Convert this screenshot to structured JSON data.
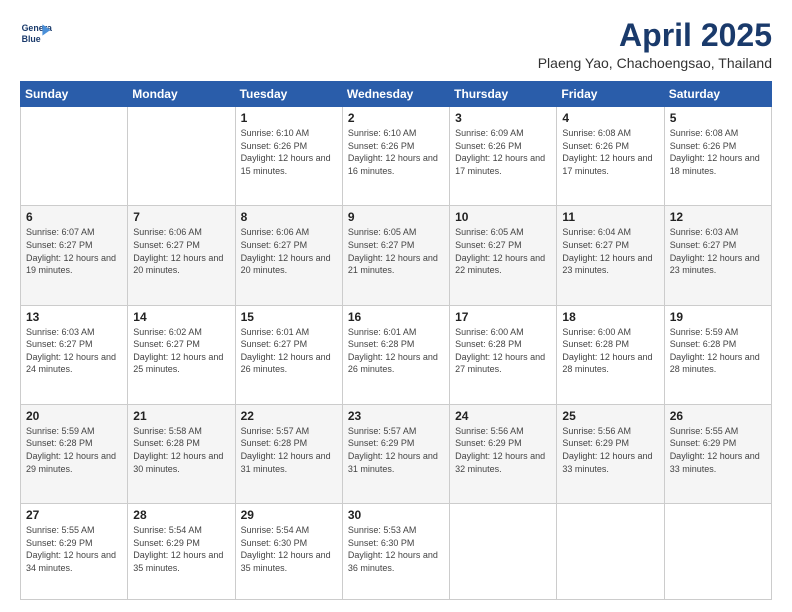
{
  "logo": {
    "line1": "General",
    "line2": "Blue"
  },
  "title": "April 2025",
  "location": "Plaeng Yao, Chachoengsao, Thailand",
  "days_of_week": [
    "Sunday",
    "Monday",
    "Tuesday",
    "Wednesday",
    "Thursday",
    "Friday",
    "Saturday"
  ],
  "weeks": [
    [
      {
        "day": "",
        "info": ""
      },
      {
        "day": "",
        "info": ""
      },
      {
        "day": "1",
        "info": "Sunrise: 6:10 AM\nSunset: 6:26 PM\nDaylight: 12 hours and 15 minutes."
      },
      {
        "day": "2",
        "info": "Sunrise: 6:10 AM\nSunset: 6:26 PM\nDaylight: 12 hours and 16 minutes."
      },
      {
        "day": "3",
        "info": "Sunrise: 6:09 AM\nSunset: 6:26 PM\nDaylight: 12 hours and 17 minutes."
      },
      {
        "day": "4",
        "info": "Sunrise: 6:08 AM\nSunset: 6:26 PM\nDaylight: 12 hours and 17 minutes."
      },
      {
        "day": "5",
        "info": "Sunrise: 6:08 AM\nSunset: 6:26 PM\nDaylight: 12 hours and 18 minutes."
      }
    ],
    [
      {
        "day": "6",
        "info": "Sunrise: 6:07 AM\nSunset: 6:27 PM\nDaylight: 12 hours and 19 minutes."
      },
      {
        "day": "7",
        "info": "Sunrise: 6:06 AM\nSunset: 6:27 PM\nDaylight: 12 hours and 20 minutes."
      },
      {
        "day": "8",
        "info": "Sunrise: 6:06 AM\nSunset: 6:27 PM\nDaylight: 12 hours and 20 minutes."
      },
      {
        "day": "9",
        "info": "Sunrise: 6:05 AM\nSunset: 6:27 PM\nDaylight: 12 hours and 21 minutes."
      },
      {
        "day": "10",
        "info": "Sunrise: 6:05 AM\nSunset: 6:27 PM\nDaylight: 12 hours and 22 minutes."
      },
      {
        "day": "11",
        "info": "Sunrise: 6:04 AM\nSunset: 6:27 PM\nDaylight: 12 hours and 23 minutes."
      },
      {
        "day": "12",
        "info": "Sunrise: 6:03 AM\nSunset: 6:27 PM\nDaylight: 12 hours and 23 minutes."
      }
    ],
    [
      {
        "day": "13",
        "info": "Sunrise: 6:03 AM\nSunset: 6:27 PM\nDaylight: 12 hours and 24 minutes."
      },
      {
        "day": "14",
        "info": "Sunrise: 6:02 AM\nSunset: 6:27 PM\nDaylight: 12 hours and 25 minutes."
      },
      {
        "day": "15",
        "info": "Sunrise: 6:01 AM\nSunset: 6:27 PM\nDaylight: 12 hours and 26 minutes."
      },
      {
        "day": "16",
        "info": "Sunrise: 6:01 AM\nSunset: 6:28 PM\nDaylight: 12 hours and 26 minutes."
      },
      {
        "day": "17",
        "info": "Sunrise: 6:00 AM\nSunset: 6:28 PM\nDaylight: 12 hours and 27 minutes."
      },
      {
        "day": "18",
        "info": "Sunrise: 6:00 AM\nSunset: 6:28 PM\nDaylight: 12 hours and 28 minutes."
      },
      {
        "day": "19",
        "info": "Sunrise: 5:59 AM\nSunset: 6:28 PM\nDaylight: 12 hours and 28 minutes."
      }
    ],
    [
      {
        "day": "20",
        "info": "Sunrise: 5:59 AM\nSunset: 6:28 PM\nDaylight: 12 hours and 29 minutes."
      },
      {
        "day": "21",
        "info": "Sunrise: 5:58 AM\nSunset: 6:28 PM\nDaylight: 12 hours and 30 minutes."
      },
      {
        "day": "22",
        "info": "Sunrise: 5:57 AM\nSunset: 6:28 PM\nDaylight: 12 hours and 31 minutes."
      },
      {
        "day": "23",
        "info": "Sunrise: 5:57 AM\nSunset: 6:29 PM\nDaylight: 12 hours and 31 minutes."
      },
      {
        "day": "24",
        "info": "Sunrise: 5:56 AM\nSunset: 6:29 PM\nDaylight: 12 hours and 32 minutes."
      },
      {
        "day": "25",
        "info": "Sunrise: 5:56 AM\nSunset: 6:29 PM\nDaylight: 12 hours and 33 minutes."
      },
      {
        "day": "26",
        "info": "Sunrise: 5:55 AM\nSunset: 6:29 PM\nDaylight: 12 hours and 33 minutes."
      }
    ],
    [
      {
        "day": "27",
        "info": "Sunrise: 5:55 AM\nSunset: 6:29 PM\nDaylight: 12 hours and 34 minutes."
      },
      {
        "day": "28",
        "info": "Sunrise: 5:54 AM\nSunset: 6:29 PM\nDaylight: 12 hours and 35 minutes."
      },
      {
        "day": "29",
        "info": "Sunrise: 5:54 AM\nSunset: 6:30 PM\nDaylight: 12 hours and 35 minutes."
      },
      {
        "day": "30",
        "info": "Sunrise: 5:53 AM\nSunset: 6:30 PM\nDaylight: 12 hours and 36 minutes."
      },
      {
        "day": "",
        "info": ""
      },
      {
        "day": "",
        "info": ""
      },
      {
        "day": "",
        "info": ""
      }
    ]
  ]
}
